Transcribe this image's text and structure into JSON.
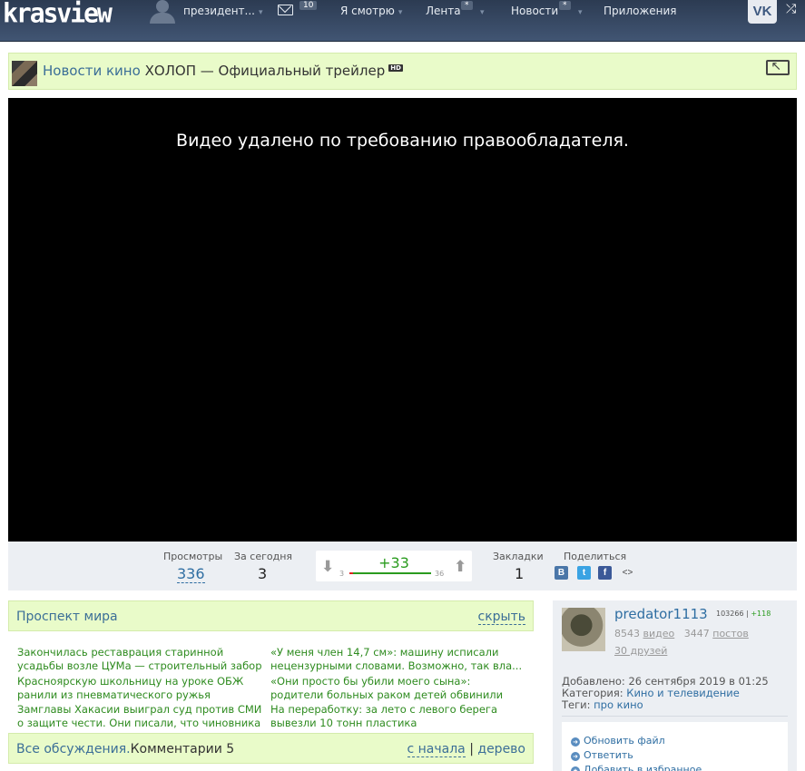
{
  "header": {
    "logo": "krasview",
    "user": "президент...",
    "mail_count": "10",
    "nav": [
      {
        "label": "Я смотрю"
      },
      {
        "label": "Лента",
        "badge": "*"
      },
      {
        "label": "Новости",
        "badge": "*"
      },
      {
        "label": "Приложения"
      }
    ],
    "vk_label": "VK"
  },
  "video": {
    "channel": "Новости кино",
    "title": "ХОЛОП — Официальный трейлер",
    "hd": "HD",
    "message": "Видео удалено по требованию правообладателя."
  },
  "stats": {
    "views_label": "Просмотры",
    "views": "336",
    "today_label": "За сегодня",
    "today": "3",
    "rating": "+33",
    "rating_min": "3",
    "rating_max": "36",
    "bookmarks_label": "Закладки",
    "bookmarks": "1",
    "share_label": "Поделиться",
    "share": [
      {
        "icon": "vk-icon",
        "glyph": "B",
        "color": "#4a76a8"
      },
      {
        "icon": "twitter-icon",
        "glyph": "t",
        "color": "#3aa3e3"
      },
      {
        "icon": "facebook-icon",
        "glyph": "f",
        "color": "#3b5998"
      }
    ]
  },
  "news": {
    "title": "Проспект мира",
    "hide": "скрыть",
    "items": [
      "Закончилась реставрация старинной усадьбы возле ЦУМа — строительный забор вокруг ...",
      "«У меня член 14,7 см»: машину исписали нецензурными словами. Возможно, так вла...",
      "Красноярскую школьницу на уроке ОБЖ ранили из пневматического ружья",
      "«Они просто бы убили моего сына»: родители больных раком детей обвинили детских он...",
      "Замглавы Хакасии выиграл суд против СМИ о защите чести. Они писали, что чиновника в...",
      "На переработку: за лето с левого берега вывезли 10 тонн пластика"
    ]
  },
  "comments": {
    "all": "Все обсуждения.",
    "label": "Комментарии 5",
    "from_start": "с начала",
    "sep": "|",
    "tree": "дерево"
  },
  "author": {
    "name": "predator1113",
    "score": "103266",
    "score_sep": "|",
    "score_plus": "+118",
    "videos_count": "8543",
    "videos_label": "видео",
    "posts_count": "3447",
    "posts_label": "постов",
    "friends": "30 друзей",
    "added_label": "Добавлено:",
    "added": "26 сентября 2019 в 01:25",
    "category_label": "Категория:",
    "category": "Кино и телевидение",
    "tags_label": "Теги:",
    "tags": "про кино",
    "actions": [
      "Обновить файл",
      "Ответить",
      "Добавить в избранное"
    ]
  }
}
